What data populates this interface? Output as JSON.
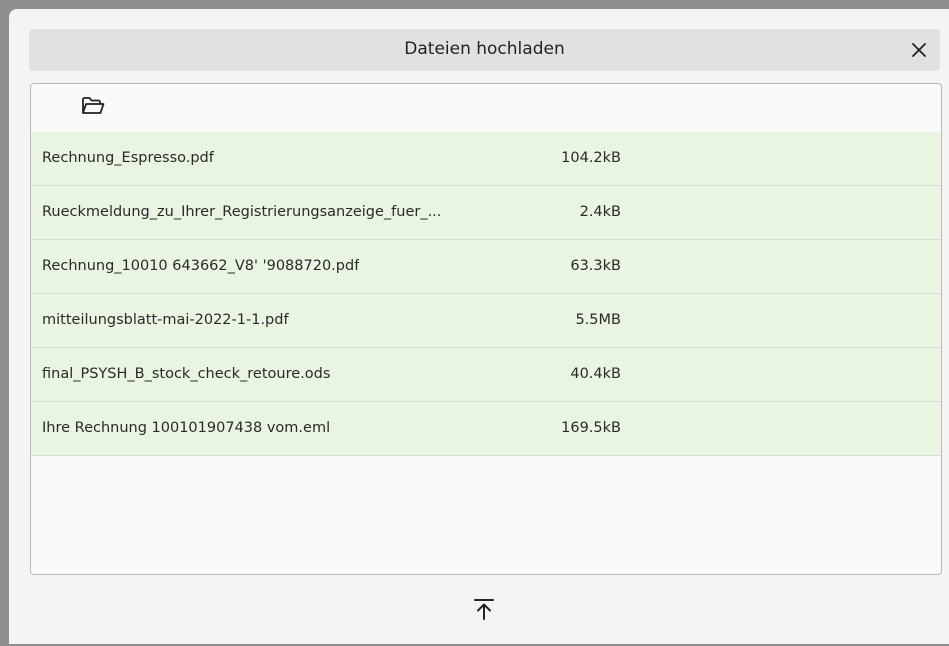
{
  "dialog": {
    "title": "Dateien hochladen",
    "close_icon": "close-icon",
    "folder_icon": "folder-open-icon",
    "upload_icon": "upload-icon"
  },
  "files": [
    {
      "name": "Rechnung_Espresso.pdf",
      "size": "104.2kB"
    },
    {
      "name": "Rueckmeldung_zu_Ihrer_Registrierungsanzeige_fuer_...",
      "size": "2.4kB"
    },
    {
      "name": "Rechnung_10010 643662_V8' '9088720.pdf",
      "size": "63.3kB"
    },
    {
      "name": "mitteilungsblatt-mai-2022-1-1.pdf",
      "size": "5.5MB"
    },
    {
      "name": "final_PSYSH_B_stock_check_retoure.ods",
      "size": "40.4kB"
    },
    {
      "name": "Ihre Rechnung 100101907438 vom.eml",
      "size": "169.5kB"
    }
  ],
  "colors": {
    "row_background": "#e9f4e1",
    "titlebar_background": "#e1e1e1",
    "dialog_background": "#f4f4f4"
  }
}
